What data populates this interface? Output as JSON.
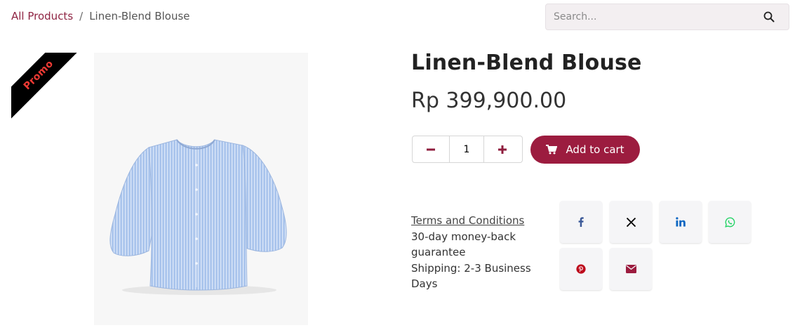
{
  "breadcrumb": {
    "root": "All Products",
    "separator": "/",
    "current": "Linen-Blend Blouse"
  },
  "search": {
    "placeholder": "Search...",
    "icon": "search-icon"
  },
  "promo": {
    "label": "Promo",
    "color": "#ef3a34"
  },
  "product": {
    "title": "Linen-Blend Blouse",
    "price": "Rp 399,900.00",
    "image": "light blue striped blouse"
  },
  "cart": {
    "quantity": "1",
    "add_label": "Add to cart",
    "accent": "#9c1c3f"
  },
  "info": {
    "terms": "Terms and Conditions",
    "guarantee": "30-day money-back guarantee",
    "shipping": "Shipping: 2-3 Business Days"
  },
  "share": [
    {
      "icon": "facebook-icon",
      "color": "#3b5998"
    },
    {
      "icon": "x-icon",
      "color": "#000000"
    },
    {
      "icon": "linkedin-icon",
      "color": "#0a66c2"
    },
    {
      "icon": "whatsapp-icon",
      "color": "#25d366"
    },
    {
      "icon": "pinterest-icon",
      "color": "#bd081c"
    },
    {
      "icon": "email-icon",
      "color": "#9c1c3f"
    }
  ]
}
